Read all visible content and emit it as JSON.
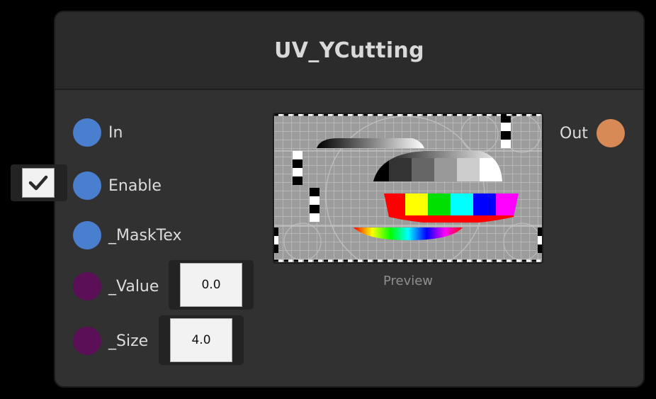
{
  "node": {
    "title": "UV_YCutting",
    "inputs": [
      {
        "label": "In",
        "type": "blue"
      },
      {
        "label": "Enable",
        "type": "blue"
      },
      {
        "label": "_MaskTex",
        "type": "blue"
      },
      {
        "label": "_Value",
        "type": "purple"
      },
      {
        "label": "_Size",
        "type": "purple"
      }
    ],
    "output": {
      "label": "Out",
      "type": "orange"
    },
    "value_field": "0.0",
    "size_field": "4.0",
    "enable_checked": true,
    "preview_label": "Preview"
  },
  "colors": {
    "node_bg": "#313131",
    "header_bg": "#2b2b2b",
    "port_blue": "#4a7fd0",
    "port_purple": "#5a0f57",
    "port_orange": "#d88a56"
  }
}
